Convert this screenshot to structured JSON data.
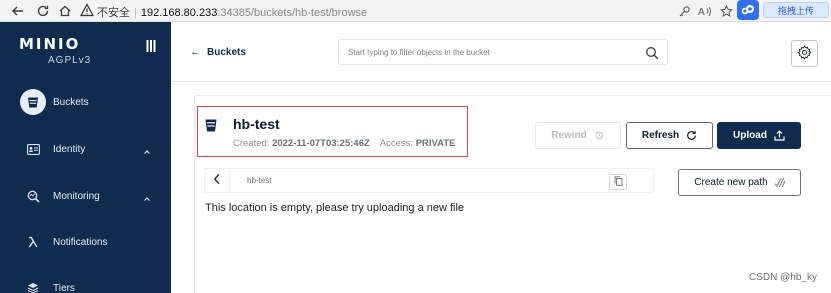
{
  "browser": {
    "insecure_label": "不安全",
    "host": "192.168.80.233",
    "path": ":34385/buckets/hb-test/browse",
    "extension_label": "拖拽上传"
  },
  "sidebar": {
    "logo_text": "MINIO",
    "logo_sub": "AGPLv3",
    "items": [
      {
        "label": "Buckets",
        "icon": "bucket-icon",
        "active": true
      },
      {
        "label": "Identity",
        "icon": "identity-icon",
        "has_chevron": true
      },
      {
        "label": "Monitoring",
        "icon": "monitoring-icon",
        "has_chevron": true
      },
      {
        "label": "Notifications",
        "icon": "lambda-icon"
      },
      {
        "label": "Tiers",
        "icon": "tiers-icon"
      }
    ]
  },
  "header": {
    "back_label": "Buckets",
    "search_placeholder": "Start typing to filter objects in the bucket"
  },
  "bucket": {
    "name": "hb-test",
    "created_label": "Created:",
    "created_value": "2022-11-07T03:25:46Z",
    "access_label": "Access:",
    "access_value": "PRIVATE"
  },
  "actions": {
    "rewind": "Rewind",
    "refresh": "Refresh",
    "upload": "Upload",
    "create_path": "Create new path"
  },
  "browser_panel": {
    "breadcrumb": "hb-test",
    "empty_message": "This location is empty, please try uploading a new file"
  },
  "watermark": "CSDN @hb_ky",
  "colors": {
    "sidebar_bg": "#0f2c4e",
    "primary": "#0f2c4e",
    "highlight_border": "#e0474c"
  }
}
